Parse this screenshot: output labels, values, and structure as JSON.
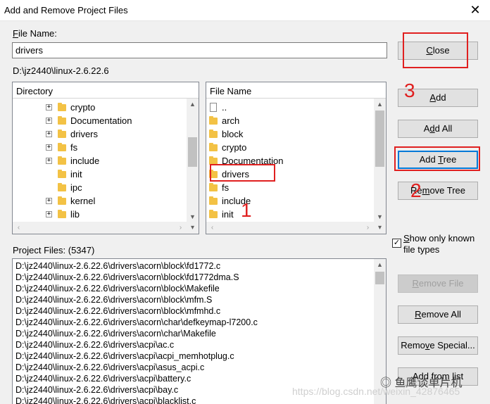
{
  "window": {
    "title": "Add and Remove Project Files"
  },
  "file_name": {
    "label_prefix": "F",
    "label_rest": "ile Name:",
    "value": "drivers"
  },
  "current_path": "D:\\jz2440\\linux-2.6.22.6",
  "directory_pane": {
    "header": "Directory",
    "items": [
      {
        "label": "crypto",
        "expandable": true
      },
      {
        "label": "Documentation",
        "expandable": true
      },
      {
        "label": "drivers",
        "expandable": true
      },
      {
        "label": "fs",
        "expandable": true
      },
      {
        "label": "include",
        "expandable": true
      },
      {
        "label": "init",
        "expandable": false
      },
      {
        "label": "ipc",
        "expandable": false
      },
      {
        "label": "kernel",
        "expandable": true
      },
      {
        "label": "lib",
        "expandable": true
      }
    ]
  },
  "filename_pane": {
    "header": "File Name",
    "items": [
      {
        "label": "..",
        "type": "file"
      },
      {
        "label": "arch",
        "type": "folder"
      },
      {
        "label": "block",
        "type": "folder"
      },
      {
        "label": "crypto",
        "type": "folder"
      },
      {
        "label": "Documentation",
        "type": "folder"
      },
      {
        "label": "drivers",
        "type": "folder"
      },
      {
        "label": "fs",
        "type": "folder"
      },
      {
        "label": "include",
        "type": "folder"
      },
      {
        "label": "init",
        "type": "folder"
      }
    ]
  },
  "buttons": {
    "close": {
      "pre": "",
      "u": "C",
      "post": "lose"
    },
    "add": {
      "pre": "",
      "u": "A",
      "post": "dd"
    },
    "add_all": {
      "pre": "A",
      "u": "d",
      "post": "d All"
    },
    "add_tree": {
      "pre": "Add ",
      "u": "T",
      "post": "ree"
    },
    "remove_tree": {
      "pre": "Re",
      "u": "m",
      "post": "ove Tree"
    },
    "remove_file": {
      "pre": "",
      "u": "R",
      "post": "emove File"
    },
    "remove_all": {
      "pre": "",
      "u": "R",
      "post": "emove All"
    },
    "remove_special": {
      "pre": "Remo",
      "u": "v",
      "post": "e Special..."
    },
    "add_from_list": {
      "pre": "Add from li",
      "u": "",
      "post": "st"
    }
  },
  "show_known": {
    "label_u": "S",
    "label_rest": "how only known",
    "label_line2": "file types",
    "checked": true,
    "check_glyph": "✓"
  },
  "project_files": {
    "label": "Project Files: (5347)",
    "items": [
      "D:\\jz2440\\linux-2.6.22.6\\drivers\\acorn\\block\\fd1772.c",
      "D:\\jz2440\\linux-2.6.22.6\\drivers\\acorn\\block\\fd1772dma.S",
      "D:\\jz2440\\linux-2.6.22.6\\drivers\\acorn\\block\\Makefile",
      "D:\\jz2440\\linux-2.6.22.6\\drivers\\acorn\\block\\mfm.S",
      "D:\\jz2440\\linux-2.6.22.6\\drivers\\acorn\\block\\mfmhd.c",
      "D:\\jz2440\\linux-2.6.22.6\\drivers\\acorn\\char\\defkeymap-l7200.c",
      "D:\\jz2440\\linux-2.6.22.6\\drivers\\acorn\\char\\Makefile",
      "D:\\jz2440\\linux-2.6.22.6\\drivers\\acpi\\ac.c",
      "D:\\jz2440\\linux-2.6.22.6\\drivers\\acpi\\acpi_memhotplug.c",
      "D:\\jz2440\\linux-2.6.22.6\\drivers\\acpi\\asus_acpi.c",
      "D:\\jz2440\\linux-2.6.22.6\\drivers\\acpi\\battery.c",
      "D:\\jz2440\\linux-2.6.22.6\\drivers\\acpi\\bay.c",
      "D:\\jz2440\\linux-2.6.22.6\\drivers\\acpi\\blacklist.c"
    ]
  },
  "annotations": {
    "n1": "1",
    "n2": "2",
    "n3": "3"
  },
  "watermark": {
    "url": "https://blog.csdn.net/weixin_42876465",
    "brand": "鱼鹰谈单片机"
  },
  "colors": {
    "accent": "#0078d7",
    "annotation_red": "#e02020",
    "folder": "#f3c245"
  }
}
